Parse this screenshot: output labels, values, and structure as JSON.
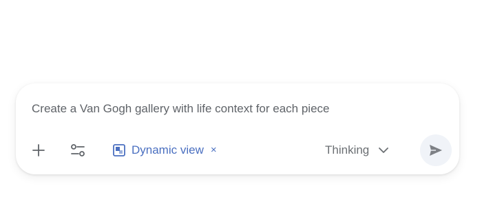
{
  "prompt": {
    "text": "Create a Van Gogh gallery with life context for each piece"
  },
  "toolbar": {
    "add_icon": "plus-icon",
    "tools_icon": "tune-icon",
    "chip": {
      "icon": "dynamic-view-icon",
      "label": "Dynamic view",
      "close": "×"
    },
    "mode": {
      "label": "Thinking",
      "icon": "chevron-down-icon"
    },
    "send_icon": "send-icon"
  },
  "colors": {
    "accent": "#4a6fc0",
    "text_muted": "#5f6368",
    "send_bg": "#f0f3f8"
  }
}
